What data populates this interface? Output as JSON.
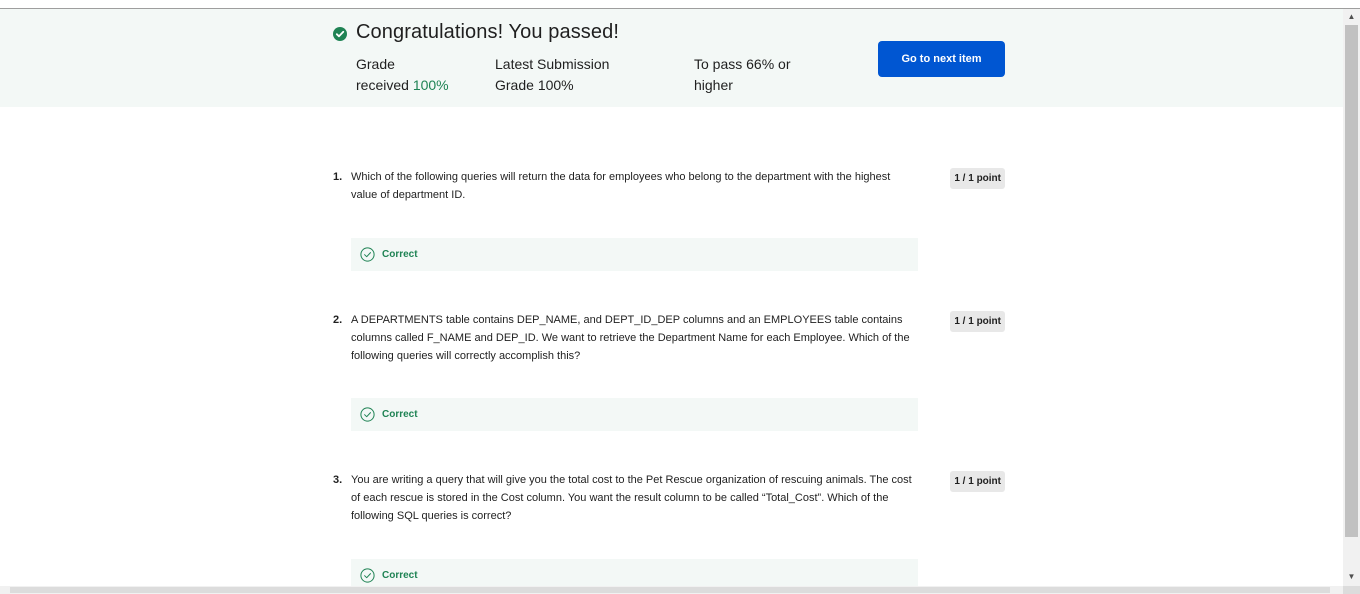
{
  "banner": {
    "title": "Congratulations! You passed!",
    "grade_label_1": "Grade",
    "grade_label_2": "received",
    "grade_value": "100%",
    "latest_label_1": "Latest Submission",
    "latest_label_2": "Grade",
    "latest_value": "100%",
    "topass_label_1": "To pass",
    "topass_value": "66% or",
    "topass_label_2": "higher",
    "next_button": "Go to next item"
  },
  "questions": [
    {
      "number": "1.",
      "text": "Which of the following queries will return the data for employees who belong to the department with the highest value of department ID.",
      "points": "1 / 1 point",
      "feedback": "Correct"
    },
    {
      "number": "2.",
      "text": "A DEPARTMENTS table contains DEP_NAME, and DEPT_ID_DEP columns and an EMPLOYEES table contains columns called F_NAME and DEP_ID. We want to retrieve the Department Name for each Employee. Which of the following queries will correctly accomplish this?",
      "points": "1 / 1 point",
      "feedback": "Correct"
    },
    {
      "number": "3.",
      "text": "You are writing a query that will give you the total cost to the Pet Rescue organization of rescuing animals. The cost of each rescue is stored in the Cost column. You want the result column to be called “Total_Cost”. Which of the following SQL queries is correct?",
      "points": "1 / 1 point",
      "feedback": "Correct"
    }
  ],
  "colors": {
    "accent": "#0056d2",
    "success": "#1f8354",
    "banner_bg": "#f3f8f6"
  },
  "icons": {
    "pass": "check-circle-filled-icon",
    "feedback": "check-circle-outline-icon"
  }
}
